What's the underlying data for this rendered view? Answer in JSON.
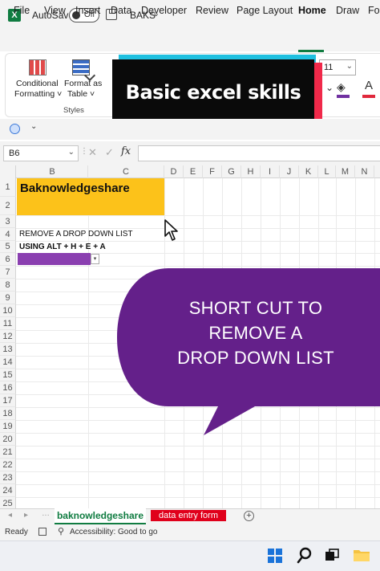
{
  "titlebar": {
    "app_logo_letter": "X",
    "autosave_label": "AutoSave",
    "autosave_state": "Off",
    "document_name": "BAKS",
    "document_chevron": "⌄"
  },
  "menu": {
    "tabs": [
      "File",
      "View",
      "Insert",
      "Data",
      "Developer",
      "Review",
      "Page Layout",
      "Home",
      "Draw",
      "Fo"
    ],
    "active_tab": "Home"
  },
  "ribbon": {
    "conditional_formatting_line1": "Conditional",
    "conditional_formatting_line2": "Formatting ˅",
    "format_as_table_line1": "Format as",
    "format_as_table_line2": "Table ˅",
    "styles_group": "Styles",
    "font_size": "11"
  },
  "banner": {
    "text": "Basic excel skills",
    "colors": {
      "back_cyan": "#1fc0e0",
      "back_red": "#f0294a",
      "front": "#0a0a0a"
    }
  },
  "formula_bar": {
    "name_box": "B6",
    "fx_label": "fx",
    "cancel_glyph": "✕",
    "enter_glyph": "✓",
    "value": ""
  },
  "grid": {
    "columns": [
      "B",
      "C",
      "D",
      "E",
      "F",
      "G",
      "H",
      "I",
      "J",
      "K",
      "L",
      "M",
      "N"
    ],
    "rows": [
      "1",
      "2",
      "3",
      "4",
      "5",
      "6",
      "7",
      "8",
      "9",
      "10",
      "11",
      "12",
      "13",
      "14",
      "15",
      "16",
      "17",
      "18",
      "19",
      "20",
      "21",
      "22",
      "23",
      "24",
      "25"
    ],
    "cells": {
      "B1": "Baknowledgeshare",
      "B4": "REMOVE A DROP DOWN LIST",
      "B5": "USING ALT + H + E + A"
    },
    "dropdown_glyph": "▾",
    "colors": {
      "header_fill": "#fcc21a",
      "dropdown_cell_fill": "#8a3fb0"
    }
  },
  "bubble": {
    "line1": "SHORT CUT TO",
    "line2": "REMOVE  A",
    "line3": "DROP DOWN LIST",
    "color": "#64208a"
  },
  "sheets": {
    "active": "baknowledgeshare",
    "other": "data entry form",
    "add_glyph": "+",
    "prev_glyph": "◂",
    "next_glyph": "▸",
    "more_glyph": "…"
  },
  "status": {
    "ready": "Ready",
    "accessibility": "Accessibility: Good to go"
  },
  "taskbar": {
    "icons": [
      "windows-start-icon",
      "search-icon",
      "task-view-icon",
      "file-explorer-icon"
    ]
  }
}
